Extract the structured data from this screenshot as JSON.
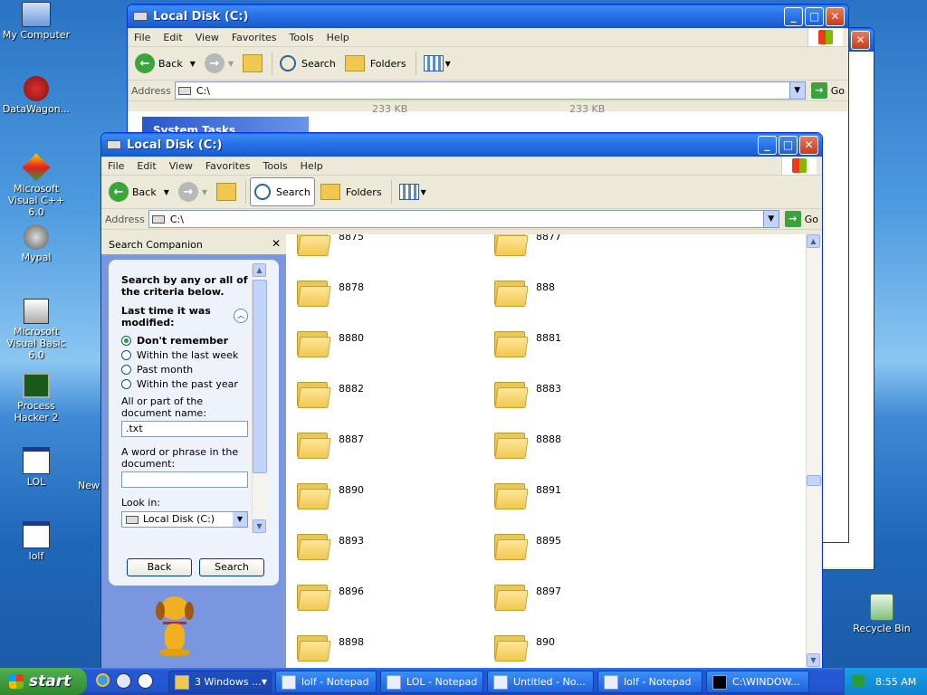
{
  "desktop": {
    "icons": [
      {
        "label": "My Computer"
      },
      {
        "label": "DataWagon..."
      },
      {
        "label": "Microsoft Visual C++ 6.0"
      },
      {
        "label": "Mypal"
      },
      {
        "label": "Microsoft Visual Basic 6.0"
      },
      {
        "label": "Process Hacker 2"
      },
      {
        "label": "LOL"
      },
      {
        "label": "lolf"
      },
      {
        "label": "New"
      },
      {
        "label": "Recycle Bin"
      }
    ]
  },
  "back_window": {
    "title": "Local Disk (C:)",
    "menu": [
      "File",
      "Edit",
      "View",
      "Favorites",
      "Tools",
      "Help"
    ],
    "toolbar": {
      "back": "Back",
      "search": "Search",
      "folders": "Folders"
    },
    "address_label": "Address",
    "address_value": "C:\\",
    "go": "Go",
    "panel_header": "System Tasks",
    "file_sizes": [
      "233 KB",
      "233 KB"
    ]
  },
  "front_window": {
    "title": "Local Disk (C:)",
    "menu": [
      "File",
      "Edit",
      "View",
      "Favorites",
      "Tools",
      "Help"
    ],
    "toolbar": {
      "back": "Back",
      "search": "Search",
      "folders": "Folders"
    },
    "address_label": "Address",
    "address_value": "C:\\",
    "go": "Go",
    "search_companion": {
      "title": "Search Companion",
      "intro": "Search by any or all of the criteria below.",
      "modified_label": "Last time it was modified:",
      "options": [
        "Don't remember",
        "Within the last week",
        "Past month",
        "Within the past year"
      ],
      "selected": 0,
      "name_label": "All or part of the document name:",
      "name_value": ".txt",
      "phrase_label": "A word or phrase in the document:",
      "phrase_value": "",
      "look_in_label": "Look in:",
      "look_in_value": "Local Disk (C:)",
      "back_button": "Back",
      "search_button": "Search"
    },
    "folders": [
      "8875",
      "8877",
      "8878",
      "888",
      "8880",
      "8881",
      "8882",
      "8883",
      "8887",
      "8888",
      "8890",
      "8891",
      "8893",
      "8895",
      "8896",
      "8897",
      "8898",
      "890"
    ]
  },
  "taskbar": {
    "start": "start",
    "tasks": [
      "3 Windows ...",
      "lolf - Notepad",
      "LOL - Notepad",
      "Untitled - No...",
      "lolf - Notepad",
      "C:\\WINDOW..."
    ],
    "clock": "8:55 AM"
  }
}
